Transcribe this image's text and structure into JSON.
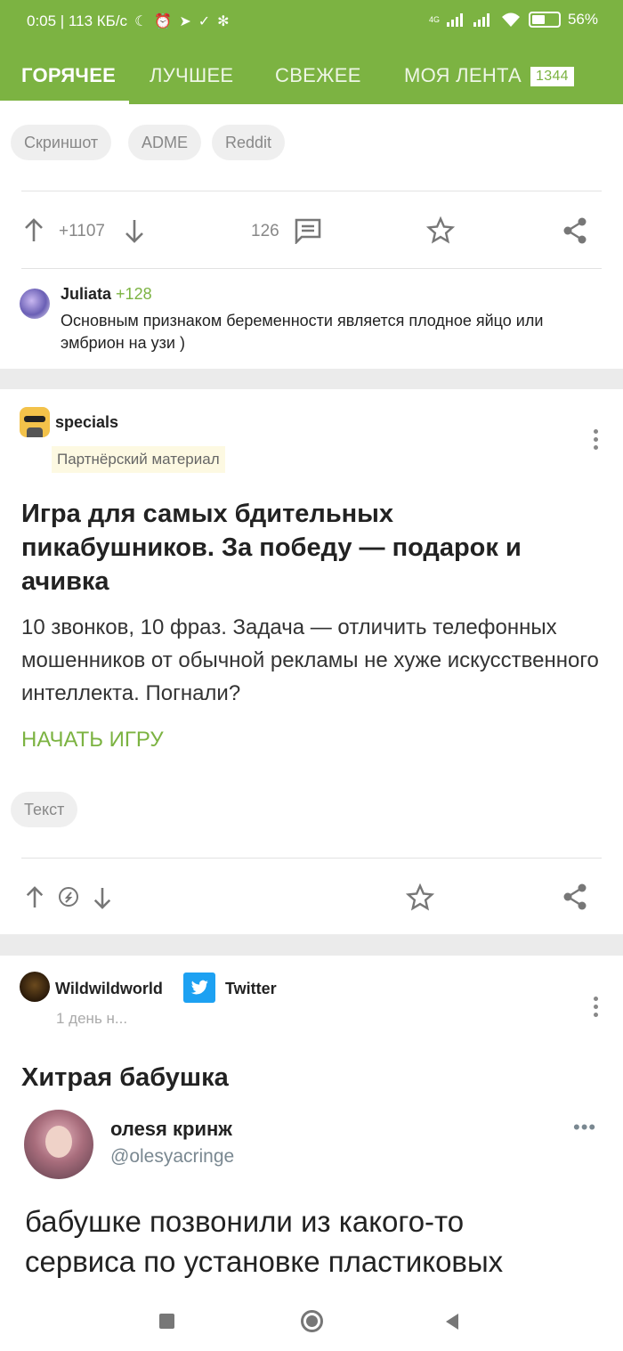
{
  "status_bar": {
    "time_speed": "0:05 | 113 КБ/с",
    "network": "4G",
    "battery": "56%",
    "battery_level": 0.56
  },
  "tabs": [
    {
      "label": "ГОРЯЧЕЕ"
    },
    {
      "label": "ЛУЧШЕЕ"
    },
    {
      "label": "СВЕЖЕЕ"
    },
    {
      "label": "МОЯ ЛЕНТА",
      "badge": "1344"
    }
  ],
  "post1": {
    "tags": [
      "Скриншот",
      "ADME",
      "Reddit"
    ],
    "rating": "+1107",
    "comments": "126",
    "top_comment": {
      "author": "Juliata",
      "score": "+128",
      "text": "Основным признаком беременности является плодное яйцо или эмбрион на узи )"
    }
  },
  "post2": {
    "author": "specials",
    "partner_label": "Партнёрский материал",
    "title": "Игра для самых бдительных пикабушников. За победу — подарок и ачивка",
    "body": "10 звонков, 10 фраз. Задача — отличить телефонных мошенников от обычной рекламы не хуже искусственного интеллекта. Погнали?",
    "cta": "НАЧАТЬ ИГРУ",
    "tag": "Текст"
  },
  "post3": {
    "author": "Wildwildworld",
    "community": "Twitter",
    "time": "1 день н...",
    "title": "Хитрая бабушка",
    "tweet": {
      "name": "олеsя кринж",
      "handle": "@olesyacringe",
      "text_line1": "бабушке позвонили из какого-то",
      "text_line2": "сервиса по установке пластиковых"
    }
  },
  "colors": {
    "brand_green": "#7cb342",
    "twitter_blue": "#1da1f2"
  }
}
